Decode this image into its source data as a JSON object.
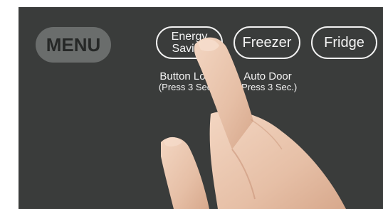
{
  "menu": {
    "label": "MENU"
  },
  "buttons": {
    "energy_saving": {
      "line1": "Energy",
      "line2": "Saving"
    },
    "freezer": {
      "label": "Freezer"
    },
    "fridge": {
      "label": "Fridge"
    }
  },
  "sublabels": {
    "energy_saving": {
      "line1": "Button Lock",
      "line2": "(Press 3 Sec.)"
    },
    "freezer": {
      "line1": "Auto Door",
      "line2": "(Press 3 Sec.)"
    }
  },
  "colors": {
    "panel": "#3a3c3b",
    "menu_button": "#6a6d6c",
    "outline": "#f2f2f2",
    "skin": "#e9c4ad"
  }
}
